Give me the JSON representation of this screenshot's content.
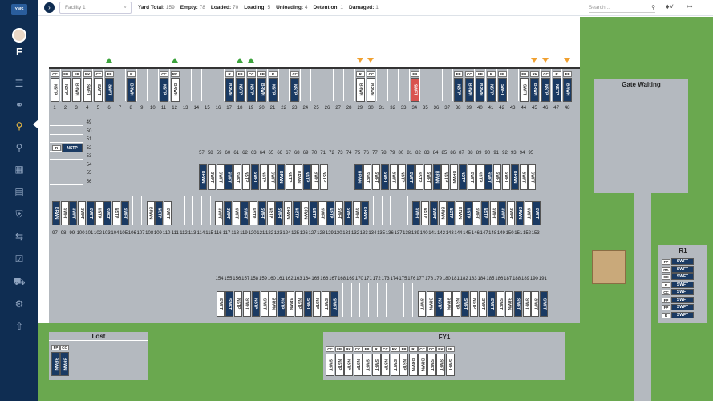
{
  "sidebar": {
    "logo": "YMS",
    "letter": "F",
    "icons": [
      "bank-icon",
      "key-icon",
      "dock-search-icon",
      "search-icon",
      "calendar-icon",
      "document-icon",
      "shield-icon",
      "swap-icon",
      "checkbox-icon",
      "truck-icon",
      "settings-icon",
      "upload-icon"
    ]
  },
  "topbar": {
    "back_icon": "chevron-right-icon",
    "facility": "Facility 1",
    "stats": [
      {
        "label": "Yard Total:",
        "value": "159"
      },
      {
        "label": "Empty:",
        "value": "78"
      },
      {
        "label": "Loaded:",
        "value": "70"
      },
      {
        "label": "Loading:",
        "value": "5"
      },
      {
        "label": "Unloading:",
        "value": "4"
      },
      {
        "label": "Detention:",
        "value": "1"
      },
      {
        "label": "Damaged:",
        "value": "1"
      }
    ],
    "search_placeholder": "Search..."
  },
  "yard": {
    "zones": {
      "gate_waiting": "Gate Waiting",
      "r1": "R1",
      "lost": "Lost",
      "fy1": "FY1"
    },
    "top_doors": {
      "numbers": [
        "1",
        "2",
        "3",
        "4",
        "5",
        "6",
        "7",
        "8",
        "9",
        "10",
        "11",
        "12",
        "13",
        "14",
        "15",
        "16",
        "17",
        "18",
        "19",
        "20",
        "21",
        "22",
        "23",
        "24",
        "25",
        "26",
        "27",
        "28",
        "29",
        "30",
        "31",
        "32",
        "33",
        "34",
        "35",
        "36",
        "37",
        "38",
        "39",
        "40",
        "41",
        "42",
        "43",
        "44",
        "45",
        "46",
        "47",
        "48"
      ],
      "trailers": [
        {
          "door": 1,
          "tag": "CC",
          "name": "NSTP",
          "style": "white"
        },
        {
          "door": 2,
          "tag": "FP",
          "name": "NSTP",
          "style": "white"
        },
        {
          "door": 3,
          "tag": "FP",
          "name": "BRWN",
          "style": "white"
        },
        {
          "door": 4,
          "tag": "RK",
          "name": "SWFT",
          "style": "white"
        },
        {
          "door": 5,
          "tag": "CC",
          "name": "SWFT",
          "style": "white"
        },
        {
          "door": 6,
          "tag": "FP",
          "name": "SWFT",
          "style": "navy"
        },
        {
          "door": 8,
          "tag": "R",
          "name": "BRWN",
          "style": "navy"
        },
        {
          "door": 11,
          "tag": "CC",
          "name": "NSTP",
          "style": "navy"
        },
        {
          "door": 12,
          "tag": "RK",
          "name": "BRWN",
          "style": "white"
        },
        {
          "door": 17,
          "tag": "R",
          "name": "BRWN",
          "style": "navy"
        },
        {
          "door": 18,
          "tag": "FP",
          "name": "NSTP",
          "style": "navy"
        },
        {
          "door": 19,
          "tag": "CC",
          "name": "NSTP",
          "style": "navy"
        },
        {
          "door": 20,
          "tag": "FP",
          "name": "BRWN",
          "style": "navy"
        },
        {
          "door": 21,
          "tag": "R",
          "name": "NSTP",
          "style": "navy"
        },
        {
          "door": 23,
          "tag": "CC",
          "name": "NSTP",
          "style": "navy"
        },
        {
          "door": 29,
          "tag": "R",
          "name": "BRWN",
          "style": "white"
        },
        {
          "door": 30,
          "tag": "CC",
          "name": "BRWN",
          "style": "white"
        },
        {
          "door": 34,
          "tag": "FP",
          "name": "SWFT",
          "style": "red"
        },
        {
          "door": 38,
          "tag": "FP",
          "name": "NSTP",
          "style": "navy"
        },
        {
          "door": 39,
          "tag": "CC",
          "name": "BRWN",
          "style": "navy"
        },
        {
          "door": 40,
          "tag": "FP",
          "name": "BRWN",
          "style": "navy"
        },
        {
          "door": 41,
          "tag": "R",
          "name": "NSTP",
          "style": "navy"
        },
        {
          "door": 42,
          "tag": "FP",
          "name": "SWFT",
          "style": "navy"
        },
        {
          "door": 44,
          "tag": "FP",
          "name": "SWFT",
          "style": "white"
        },
        {
          "door": 45,
          "tag": "RK",
          "name": "BRWN",
          "style": "navy"
        },
        {
          "door": 46,
          "tag": "CC",
          "name": "NSTP",
          "style": "navy"
        },
        {
          "door": 47,
          "tag": "R",
          "name": "NSTP",
          "style": "navy"
        },
        {
          "door": 48,
          "tag": "FP",
          "name": "BRWN",
          "style": "navy"
        }
      ],
      "green_arrows": [
        6,
        12,
        18,
        19
      ],
      "orange_arrows": [
        29,
        30,
        45,
        46,
        48
      ]
    },
    "side_slots": {
      "numbers": [
        "49",
        "50",
        "51",
        "52",
        "53",
        "54",
        "55",
        "56"
      ],
      "parked": {
        "tag": "R",
        "name": "NSTP"
      }
    },
    "row_a_numbers": [
      "57",
      "58",
      "59",
      "60",
      "61",
      "62",
      "63",
      "64",
      "65",
      "66",
      "67",
      "68",
      "69",
      "70",
      "71",
      "72",
      "73",
      "74",
      "75",
      "76",
      "77",
      "78",
      "79",
      "80",
      "81",
      "82",
      "83",
      "84",
      "85",
      "86",
      "87",
      "88",
      "89",
      "90",
      "91",
      "92",
      "93",
      "94",
      "95"
    ],
    "row_b_numbers": [
      "97",
      "98",
      "99",
      "100",
      "101",
      "102",
      "103",
      "104",
      "105",
      "106",
      "107",
      "108",
      "109",
      "110",
      "111",
      "112",
      "113",
      "114",
      "115",
      "116",
      "117",
      "118",
      "119",
      "120",
      "121",
      "122",
      "123",
      "124",
      "125",
      "126",
      "127",
      "128",
      "129",
      "130",
      "131",
      "132",
      "133",
      "134",
      "135",
      "136",
      "137",
      "138",
      "139",
      "140",
      "141",
      "142",
      "143",
      "144",
      "145",
      "146",
      "147",
      "148",
      "149",
      "150",
      "151",
      "152",
      "153"
    ],
    "row_c_numbers": [
      "154",
      "155",
      "156",
      "157",
      "158",
      "159",
      "160",
      "161",
      "162",
      "163",
      "164",
      "165",
      "166",
      "167",
      "168",
      "169",
      "170",
      "171",
      "172",
      "173",
      "174",
      "175",
      "176",
      "177",
      "178",
      "179",
      "180",
      "181",
      "182",
      "183",
      "184",
      "185",
      "186",
      "187",
      "188",
      "189",
      "190",
      "191"
    ],
    "r1_trailers": [
      "SWFT",
      "SWFT",
      "SWFT",
      "SWFT",
      "SWFT",
      "SWFT",
      "SWFT",
      "SWFT"
    ],
    "r1_tags": [
      "FP",
      "RK",
      "CC",
      "R",
      "CC",
      "FP",
      "FP",
      "R"
    ],
    "lost_trailers": [
      {
        "tag": "FP",
        "name": "BRWN"
      },
      {
        "tag": "CC",
        "name": "BRWN"
      }
    ],
    "fy1_tags": [
      "CC",
      "FP",
      "RK",
      "CC",
      "FP",
      "R",
      "CC",
      "RK",
      "FP",
      "R",
      "CC",
      "CC",
      "RK",
      "FP"
    ],
    "fy1_names": [
      "SWFT",
      "NSTP",
      "NSTP",
      "NSTP",
      "SWFT",
      "SWFT",
      "NSTP",
      "SWFT",
      "NSTP",
      "BRWN",
      "BRWN",
      "SWFT",
      "SWFT",
      "SWFT"
    ]
  }
}
